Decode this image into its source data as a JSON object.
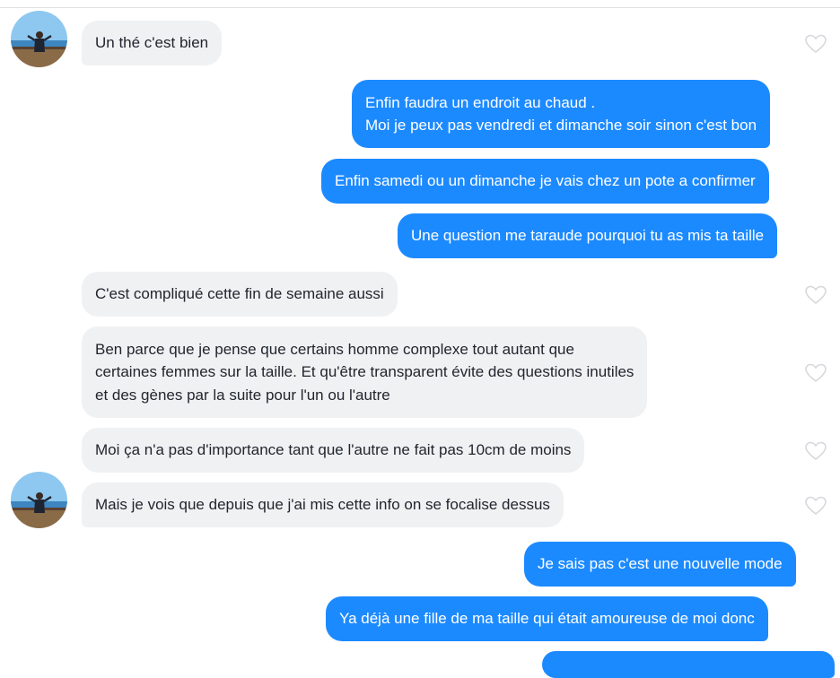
{
  "colors": {
    "incoming_bubble": "#f0f1f3",
    "outgoing_bubble": "#1c8aff",
    "incoming_text": "#21262e",
    "outgoing_text": "#ffffff",
    "heart_outline": "#d6d8dd"
  },
  "conversation": {
    "messages": [
      {
        "side": "in",
        "lines": [
          "Un thé c'est bien"
        ]
      },
      {
        "side": "out",
        "lines": [
          "Enfin faudra un endroit au chaud .",
          "Moi je peux pas vendredi et dimanche soir sinon c'est bon"
        ]
      },
      {
        "side": "out",
        "lines": [
          "Enfin samedi ou un dimanche je vais chez un pote a confirmer"
        ]
      },
      {
        "side": "out",
        "lines": [
          "Une question me taraude pourquoi tu as mis ta taille"
        ]
      },
      {
        "side": "in",
        "lines": [
          "C'est compliqué cette fin de semaine aussi"
        ]
      },
      {
        "side": "in",
        "lines": [
          "Ben parce que je pense que certains homme complexe tout autant que",
          "certaines femmes sur la taille. Et qu'être transparent évite des questions inutiles",
          "et des gènes par la suite pour l'un ou l'autre"
        ]
      },
      {
        "side": "in",
        "lines": [
          "Moi ça n'a pas d'importance tant que l'autre ne fait pas 10cm de moins"
        ]
      },
      {
        "side": "in",
        "lines": [
          "Mais je vois que depuis que j'ai mis cette info on se focalise dessus"
        ]
      },
      {
        "side": "out",
        "lines": [
          "Je sais pas c'est une nouvelle mode"
        ]
      },
      {
        "side": "out",
        "lines": [
          "Ya déjà une fille de ma taille qui était amoureuse de moi donc"
        ]
      }
    ]
  }
}
